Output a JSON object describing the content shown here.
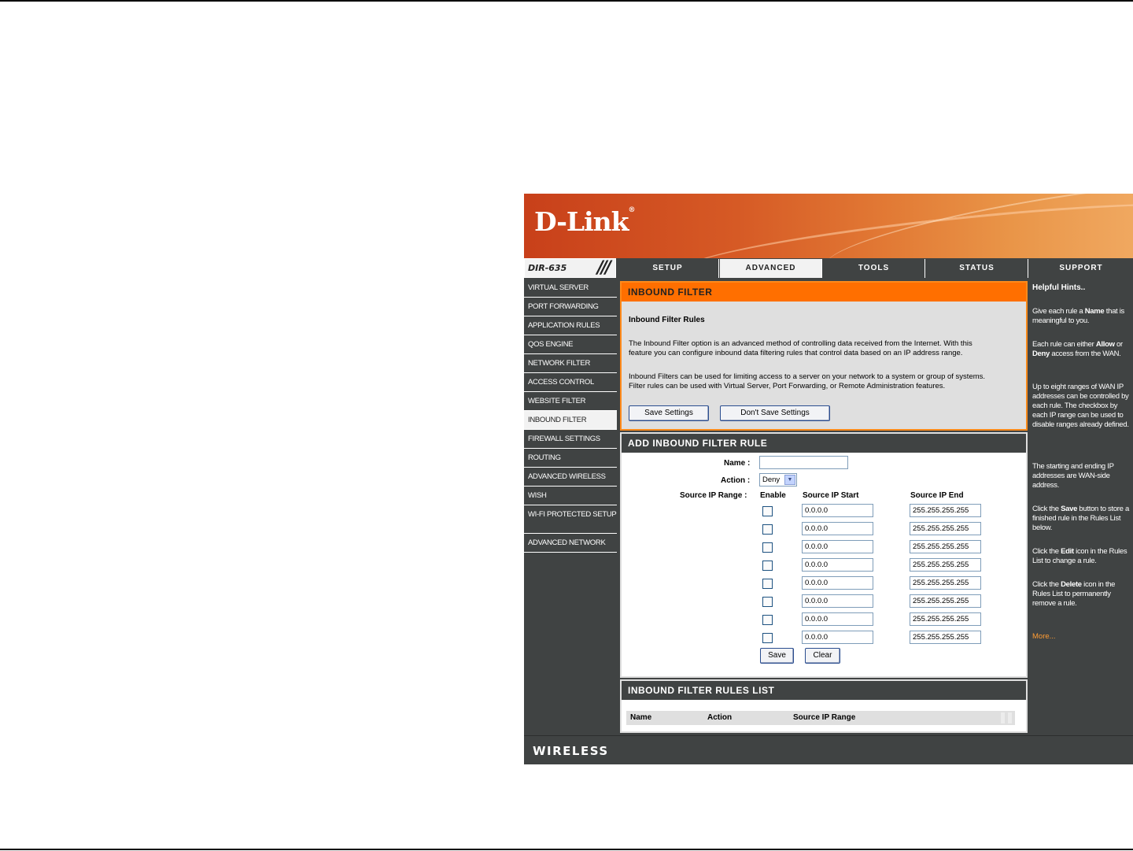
{
  "brand": {
    "logo_text": "D-Link",
    "model": "DIR-635",
    "footer": "WIRELESS"
  },
  "tabs": [
    {
      "label": "SETUP",
      "active": false
    },
    {
      "label": "ADVANCED",
      "active": true
    },
    {
      "label": "TOOLS",
      "active": false
    },
    {
      "label": "STATUS",
      "active": false
    },
    {
      "label": "SUPPORT",
      "active": false
    }
  ],
  "sidebar": {
    "items": [
      {
        "label": "VIRTUAL SERVER"
      },
      {
        "label": "PORT FORWARDING"
      },
      {
        "label": "APPLICATION RULES"
      },
      {
        "label": "QOS ENGINE"
      },
      {
        "label": "NETWORK FILTER"
      },
      {
        "label": "ACCESS CONTROL"
      },
      {
        "label": "WEBSITE FILTER"
      },
      {
        "label": "INBOUND FILTER",
        "active": true
      },
      {
        "label": "FIREWALL SETTINGS"
      },
      {
        "label": "ROUTING"
      },
      {
        "label": "ADVANCED WIRELESS"
      },
      {
        "label": "WISH"
      },
      {
        "label": "WI-FI PROTECTED SETUP"
      },
      {
        "label": "ADVANCED NETWORK"
      }
    ]
  },
  "inbound_filter": {
    "heading": "INBOUND FILTER",
    "subtitle": "Inbound Filter Rules",
    "para1_line1": "The Inbound Filter option is an advanced method of controlling data received from the Internet. With this",
    "para1_line2": "feature you can configure inbound data filtering rules that control data based on an IP address range.",
    "para2_line1": "Inbound Filters can be used for limiting access to a server on your network to a system or group of systems.",
    "para2_line2": "Filter rules can be used with Virtual Server, Port Forwarding, or Remote Administration features.",
    "save_label": "Save Settings",
    "dont_save_label": "Don't Save Settings"
  },
  "add_rule": {
    "heading": "ADD INBOUND FILTER RULE",
    "name_label": "Name :",
    "name_value": "",
    "action_label": "Action :",
    "action_value": "Deny",
    "range_label": "Source IP Range :",
    "col_enable": "Enable",
    "col_start": "Source IP Start",
    "col_end": "Source IP End",
    "ranges": [
      {
        "enabled": false,
        "start": "0.0.0.0",
        "end": "255.255.255.255"
      },
      {
        "enabled": false,
        "start": "0.0.0.0",
        "end": "255.255.255.255"
      },
      {
        "enabled": false,
        "start": "0.0.0.0",
        "end": "255.255.255.255"
      },
      {
        "enabled": false,
        "start": "0.0.0.0",
        "end": "255.255.255.255"
      },
      {
        "enabled": false,
        "start": "0.0.0.0",
        "end": "255.255.255.255"
      },
      {
        "enabled": false,
        "start": "0.0.0.0",
        "end": "255.255.255.255"
      },
      {
        "enabled": false,
        "start": "0.0.0.0",
        "end": "255.255.255.255"
      },
      {
        "enabled": false,
        "start": "0.0.0.0",
        "end": "255.255.255.255"
      }
    ],
    "save_label": "Save",
    "clear_label": "Clear"
  },
  "rules_list": {
    "heading": "INBOUND FILTER RULES LIST",
    "columns": [
      "Name",
      "Action",
      "Source IP Range"
    ]
  },
  "support": {
    "title": "Helpful Hints..",
    "hints": [
      {
        "t1": "Give each rule a ",
        "b1": "Name",
        "t2": " that is meaningful to you.",
        "b2": "",
        "t3": ""
      },
      {
        "t1": "Each rule can either ",
        "b1": "Allow",
        "t2": " or ",
        "b2": "Deny",
        "t3": " access from the WAN."
      },
      {
        "t1": "Up to eight ranges of WAN IP addresses can be controlled by each rule. The checkbox by each IP range can be used to disable ranges already defined.",
        "b1": "",
        "t2": "",
        "b2": "",
        "t3": ""
      },
      {
        "t1": "The starting and ending IP addresses are WAN-side address.",
        "b1": "",
        "t2": "",
        "b2": "",
        "t3": ""
      },
      {
        "t1": "Click the ",
        "b1": "Save",
        "t2": " button to store a finished rule in the Rules List below.",
        "b2": "",
        "t3": ""
      },
      {
        "t1": "Click the ",
        "b1": "Edit",
        "t2": " icon in the Rules List to change a rule.",
        "b2": "",
        "t3": ""
      },
      {
        "t1": "Click the ",
        "b1": "Delete",
        "t2": " icon in the Rules List to permanently remove a rule.",
        "b2": "",
        "t3": ""
      }
    ],
    "more": "More..."
  },
  "colors": {
    "orange_header": "#ff6f00",
    "dark_bar": "#404343",
    "panel_grey": "#dfdfdf",
    "link_orange": "#ff9c33"
  }
}
